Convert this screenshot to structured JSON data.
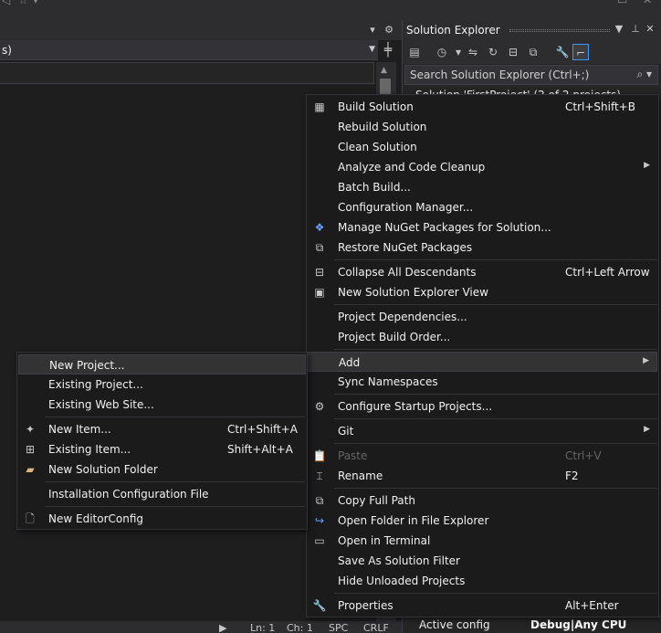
{
  "solution_explorer": {
    "title": "Solution Explorer",
    "search_placeholder": "Search Solution Explorer (Ctrl+;)",
    "tree_partial": "Solution 'FirstProject' (2 of 2 projects)",
    "properties": {
      "key": "Active config",
      "value": "Debug|Any CPU"
    }
  },
  "editor": {
    "combo_text": "s)"
  },
  "status_bar": {
    "ln": "Ln: 1",
    "ch": "Ch: 1",
    "spc": "SPC",
    "crlf": "CRLF"
  },
  "context_menu": {
    "items": [
      {
        "icon": "build-icon",
        "label": "Build Solution",
        "shortcut": "Ctrl+Shift+B"
      },
      {
        "label": "Rebuild Solution",
        "shortcut": ""
      },
      {
        "label": "Clean Solution",
        "shortcut": ""
      },
      {
        "label": "Analyze and Code Cleanup",
        "shortcut": "",
        "submenu": true
      },
      {
        "label": "Batch Build...",
        "shortcut": ""
      },
      {
        "label": "Configuration Manager...",
        "shortcut": ""
      },
      {
        "icon": "nuget-icon",
        "label": "Manage NuGet Packages for Solution...",
        "shortcut": ""
      },
      {
        "icon": "restore-icon",
        "label": "Restore NuGet Packages",
        "shortcut": ""
      },
      {
        "icon": "collapse-icon",
        "label": "Collapse All Descendants",
        "shortcut": "Ctrl+Left Arrow"
      },
      {
        "icon": "new-view-icon",
        "label": "New Solution Explorer View",
        "shortcut": ""
      },
      {
        "label": "Project Dependencies...",
        "shortcut": ""
      },
      {
        "label": "Project Build Order...",
        "shortcut": ""
      },
      {
        "label": "Add",
        "shortcut": "",
        "submenu": true
      },
      {
        "label": "Sync Namespaces",
        "shortcut": ""
      },
      {
        "icon": "gear-icon",
        "label": "Configure Startup Projects...",
        "shortcut": ""
      },
      {
        "label": "Git",
        "shortcut": "",
        "submenu": true
      },
      {
        "icon": "paste-icon",
        "label": "Paste",
        "shortcut": "Ctrl+V",
        "disabled": true
      },
      {
        "icon": "rename-icon",
        "label": "Rename",
        "shortcut": "F2"
      },
      {
        "icon": "copy-icon",
        "label": "Copy Full Path",
        "shortcut": ""
      },
      {
        "icon": "open-folder-icon",
        "label": "Open Folder in File Explorer",
        "shortcut": ""
      },
      {
        "icon": "terminal-icon",
        "label": "Open in Terminal",
        "shortcut": ""
      },
      {
        "label": "Save As Solution Filter",
        "shortcut": ""
      },
      {
        "label": "Hide Unloaded Projects",
        "shortcut": ""
      },
      {
        "icon": "wrench-icon",
        "label": "Properties",
        "shortcut": "Alt+Enter"
      }
    ]
  },
  "add_submenu": {
    "items": [
      {
        "label": "New Project...",
        "shortcut": ""
      },
      {
        "label": "Existing Project...",
        "shortcut": ""
      },
      {
        "label": "Existing Web Site...",
        "shortcut": ""
      },
      {
        "icon": "new-item-icon",
        "label": "New Item...",
        "shortcut": "Ctrl+Shift+A"
      },
      {
        "icon": "existing-item-icon",
        "label": "Existing Item...",
        "shortcut": "Shift+Alt+A"
      },
      {
        "icon": "folder-icon",
        "label": "New Solution Folder",
        "shortcut": ""
      },
      {
        "label": "Installation Configuration File",
        "shortcut": ""
      },
      {
        "icon": "file-icon",
        "label": "New EditorConfig",
        "shortcut": ""
      }
    ]
  },
  "colors": {
    "background": "#1e1e1e",
    "menu_background": "#1b1b1c",
    "highlight": "#333334",
    "accent": "#3399ff"
  }
}
